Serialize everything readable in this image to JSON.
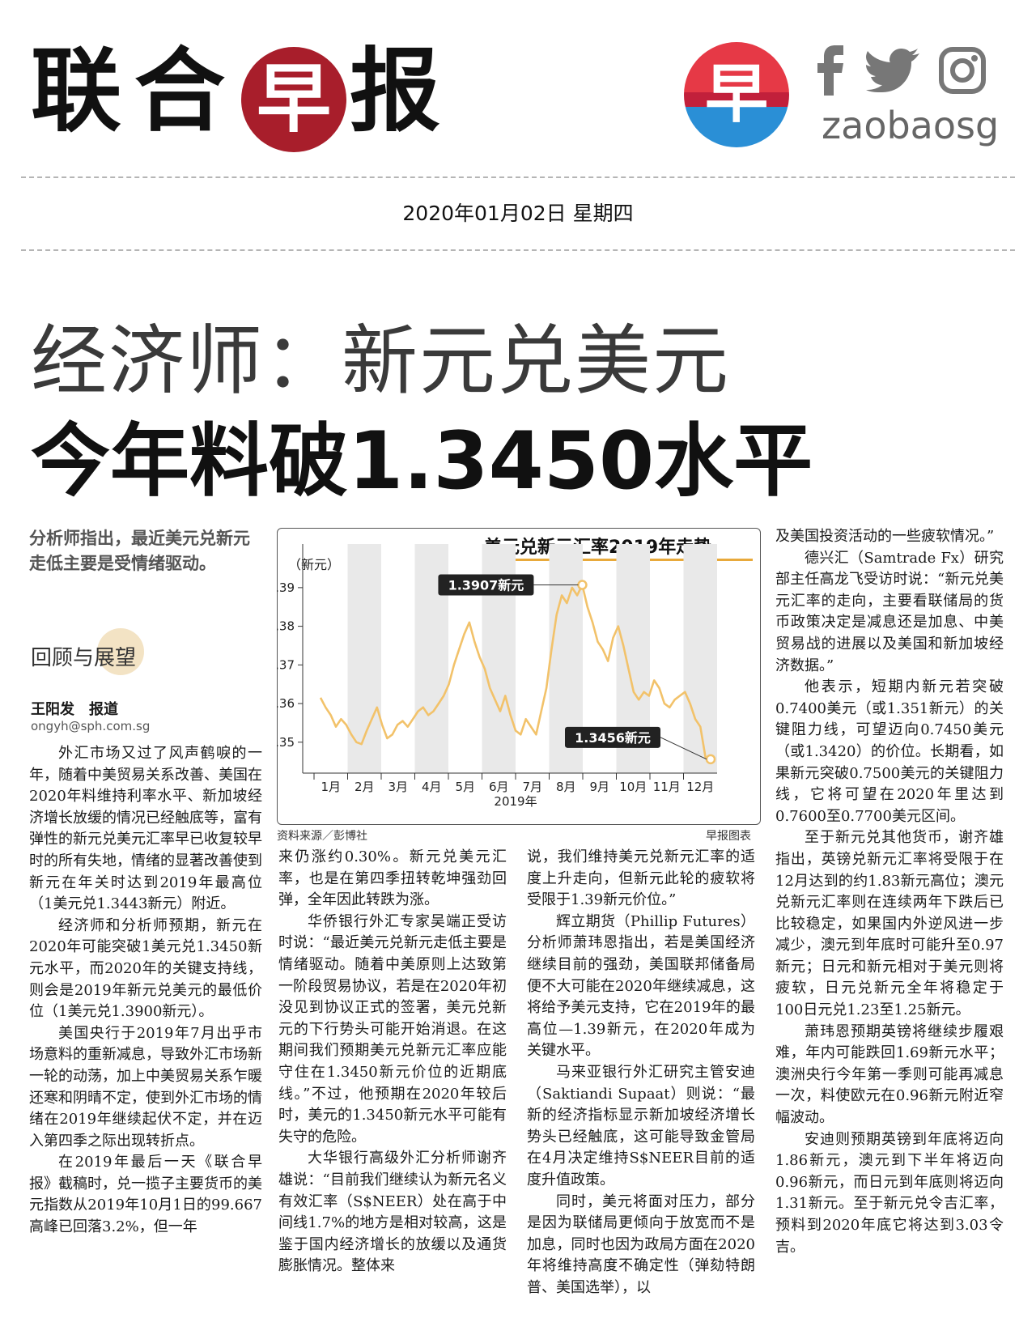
{
  "masthead": {
    "logo_chars": [
      "联",
      "合",
      "报"
    ],
    "logo_circle_char": "早",
    "app_icon_char": "早",
    "handle": "zaobaosg",
    "social_icons": [
      "facebook-icon",
      "twitter-icon",
      "instagram-icon"
    ],
    "colors": {
      "logo_circle": "#a81e2b",
      "icon_red": "#e63946",
      "icon_blue": "#2a8fd6"
    }
  },
  "date": "2020年01月02日 星期四",
  "headline": {
    "line1": "经济师：新元兑美元",
    "line2": "今年料破1.3450水平"
  },
  "lead": "分析师指出，最近美元兑新元走低主要是受情绪驱动。",
  "rubric": "回顾与展望",
  "byline": "王阳发　报道",
  "email": "ongyh@sph.com.sg",
  "chart_data": {
    "type": "line",
    "title": "美元兑新元汇率2019年走势",
    "ylabel": "（新元）",
    "xlabel": "2019年",
    "categories": [
      "1月",
      "2月",
      "3月",
      "4月",
      "5月",
      "6月",
      "7月",
      "8月",
      "9月",
      "10月",
      "11月",
      "12月"
    ],
    "yticks": [
      "1.35",
      "1.36",
      "1.37",
      "1.38",
      "1.39"
    ],
    "ylim": [
      1.342,
      1.395
    ],
    "series": [
      {
        "values": [
          1.3615,
          1.359,
          1.357,
          1.354,
          1.356,
          1.3545,
          1.352,
          1.35,
          1.3495,
          1.353,
          1.356,
          1.359,
          1.3545,
          1.351,
          1.352,
          1.3545,
          1.3555,
          1.354,
          1.356,
          1.358,
          1.359,
          1.357,
          1.358,
          1.36,
          1.362,
          1.365,
          1.37,
          1.374,
          1.378,
          1.381,
          1.376,
          1.372,
          1.369,
          1.364,
          1.361,
          1.358,
          1.362,
          1.357,
          1.353,
          1.352,
          1.356,
          1.354,
          1.352,
          1.358,
          1.364,
          1.374,
          1.383,
          1.388,
          1.386,
          1.39,
          1.388,
          1.3907,
          1.385,
          1.381,
          1.376,
          1.374,
          1.371,
          1.377,
          1.38,
          1.375,
          1.369,
          1.363,
          1.361,
          1.363,
          1.362,
          1.366,
          1.364,
          1.36,
          1.359,
          1.361,
          1.362,
          1.363,
          1.36,
          1.356,
          1.354,
          1.346,
          1.3456
        ]
      }
    ],
    "annotations": [
      {
        "label": "1.3907新元",
        "x": 51,
        "y": 1.3907
      },
      {
        "label": "1.3456新元",
        "x": 76,
        "y": 1.3456
      }
    ],
    "grid": "alternating month bands",
    "line_color": "#f2c26a"
  },
  "chart_source": "资料来源／彭博社",
  "chart_credit": "早报图表",
  "col1": [
    "外汇市场又过了风声鹤唳的一年，随着中美贸易关系改善、美国在2020年料维持利率水平、新加坡经济增长放缓的情况已经触底等，富有弹性的新元兑美元汇率早已收复较早时的所有失地，情绪的显著改善使到新元在年关时达到2019年最高位（1美元兑1.3443新元）附近。",
    "经济师和分析师预期，新元在2020年可能突破1美元兑1.3450新元水平，而2020年的关键支持线，则会是2019年新元兑美元的最低价位（1美元兑1.3900新元）。",
    "美国央行于2019年7月出乎市场意料的重新减息，导致外汇市场新一轮的动荡，加上中美贸易关系乍暖还寒和阴晴不定，使到外汇市场的情绪在2019年继续起伏不定，并在迈入第四季之际出现转折点。",
    "在2019年最后一天《联合早报》截稿时，兑一揽子主要货币的美元指数从2019年10月1日的99.667高峰已回落3.2%，但一年"
  ],
  "col2": [
    "来仍涨约0.30%。新元兑美元汇率，也是在第四季扭转乾坤强劲回弹，全年因此转跌为涨。",
    "华侨银行外汇专家吴端正受访时说：“最近美元兑新元走低主要是情绪驱动。随着中美原则上达致第一阶段贸易协议，若是在2020年初没见到协议正式的签署，美元兑新元的下行势头可能开始消退。在这期间我们预期美元兑新元汇率应能守住在1.3450新元价位的近期底线。”不过，他预期在2020年较后时，美元的1.3450新元水平可能有失守的危险。",
    "大华银行高级外汇分析师谢齐雄说：“目前我们继续认为新元名义有效汇率（S$NEER）处在高于中间线1.7%的地方是相对较高，这是鉴于国内经济增长的放缓以及通货膨胀情况。整体来"
  ],
  "col3": [
    "说，我们维持美元兑新元汇率的适度上升走向，但新元此轮的疲软将受限于1.39新元价位。”",
    "辉立期货（Phillip Futures）分析师萧玮恩指出，若是美国经济继续目前的强劲，美国联邦储备局便不大可能在2020年继续减息，这将给予美元支持，它在2019年的最高位—1.39新元，在2020年成为关键水平。",
    "马来亚银行外汇研究主管安迪（Saktiandi Supaat）则说：“最新的经济指标显示新加坡经济增长势头已经触底，这可能导致金管局在4月决定维持S$NEER目前的适度升值政策。",
    "同时，美元将面对压力，部分是因为联储局更倾向于放宽而不是加息，同时也因为政局方面在2020年将维持高度不确定性（弹劾特朗普、美国选举），以"
  ],
  "col4": [
    "及美国投资活动的一些疲软情况。”",
    "德兴汇（Samtrade Fx）研究部主任高龙飞受访时说：“新元兑美元汇率的走向，主要看联储局的货币政策决定是减息还是加息、中美贸易战的进展以及美国和新加坡经济数据。”",
    "他表示，短期内新元若突破0.7400美元（或1.351新元）的关键阻力线，可望迈向0.7450美元（或1.3420）的价位。长期看，如果新元突破0.7500美元的关键阻力线，它将可望在2020年里达到0.7600至0.7700美元区间。",
    "至于新元兑其他货币，谢齐雄指出，英镑兑新元汇率将受限于在12月达到的约1.83新元高位；澳元兑新元汇率则在连续两年下跌后已比较稳定，如果国内外逆风进一步减少，澳元到年底时可能升至0.97新元；日元和新元相对于美元则将疲软，日元兑新元全年将稳定于100日元兑1.23至1.25新元。",
    "萧玮恩预期英镑将继续步履艰难，年内可能跌回1.69新元水平；澳洲央行今年第一季则可能再减息一次，料使欧元在0.96新元附近窄幅波动。",
    "安迪则预期英镑到年底将迈向1.86新元，澳元到下半年将迈向0.96新元，而日元到年底则将迈向1.31新元。至于新元兑令吉汇率，预料到2020年底它将达到3.03令吉。"
  ]
}
